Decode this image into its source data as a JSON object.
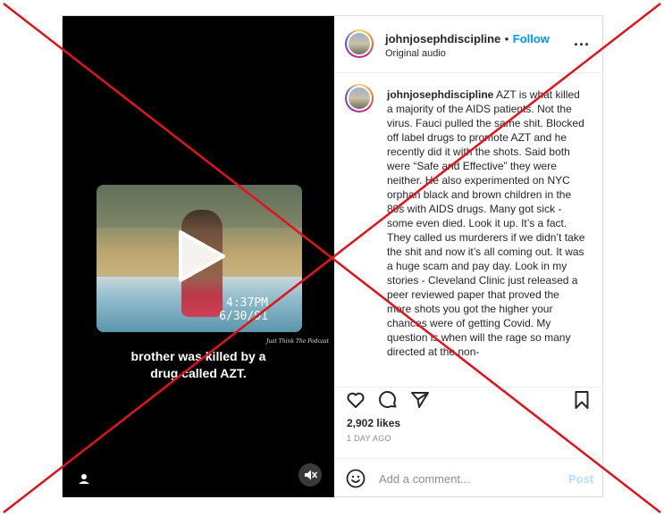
{
  "media": {
    "timestamp_time": "4:37PM",
    "timestamp_date": "6/30/91",
    "credit": "Just Think The Podcast",
    "caption_line1": "brother was killed by a",
    "caption_line2": "drug called AZT."
  },
  "header": {
    "username": "johnjosephdiscipline",
    "separator": "•",
    "follow_label": "Follow",
    "audio": "Original audio",
    "more": "..."
  },
  "post": {
    "username": "johnjosephdiscipline",
    "text": "AZT is what killed a majority of the AIDS patients. Not the virus. Fauci pulled the same shit. Blocked off label drugs to promote AZT and he recently did it with the shots. Said both were “Safe and Effective” they were neither. He also experimented on NYC orphan black and brown children in the 80s with AIDS drugs. Many got sick - some even died. Look it up. It’s a fact. They called us murderers if we didn’t take the shit and now it’s all coming out. It was a huge scam and pay day. Look in my stories - Cleveland Clinic just released a peer reviewed paper that proved the more shots you got the higher your chances were of getting Covid. My question is when will the rage so many directed at the non-"
  },
  "engagement": {
    "likes": "2,902 likes",
    "date": "1 DAY AGO"
  },
  "comment_box": {
    "placeholder": "Add a comment...",
    "post_label": "Post"
  },
  "colors": {
    "accent": "#0095f6",
    "overlay_x": "#e0141e"
  }
}
